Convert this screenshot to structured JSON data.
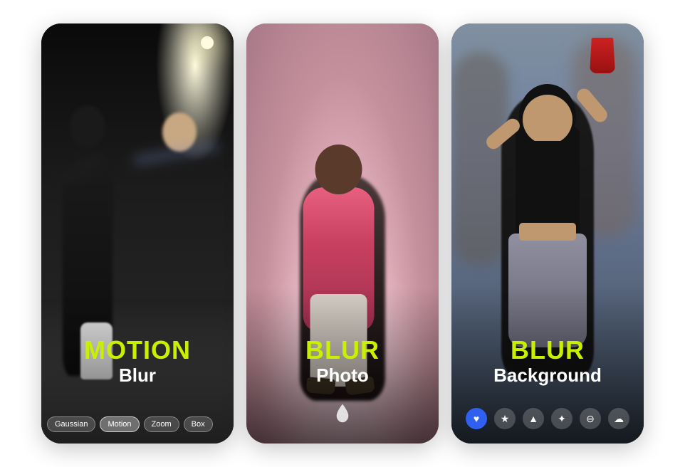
{
  "cards": [
    {
      "id": "motion-blur",
      "title": "MOTION",
      "subtitle": "Blur",
      "filters": [
        {
          "label": "Gaussian",
          "active": false
        },
        {
          "label": "Motion",
          "active": true
        },
        {
          "label": "Zoom",
          "active": false
        },
        {
          "label": "Box",
          "active": false
        }
      ],
      "bg_description": "dark nighttime street dancing scene"
    },
    {
      "id": "blur-photo",
      "title": "BLUR",
      "subtitle": "Photo",
      "bg_description": "pink misty studio photo of man in pink jacket",
      "bottom_icon": "drop"
    },
    {
      "id": "blur-background",
      "title": "BLUR",
      "subtitle": "Background",
      "bg_description": "party scene woman dancing with red cup",
      "icons": [
        "heart",
        "star",
        "triangle",
        "cross",
        "minus",
        "cloud"
      ]
    }
  ],
  "colors": {
    "accent_yellow_green": "#c8f000",
    "white": "#ffffff",
    "dark": "#111111"
  }
}
